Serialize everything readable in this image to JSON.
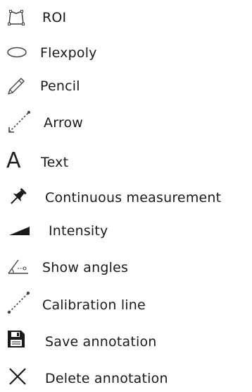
{
  "menu": {
    "items": [
      {
        "label": "ROI",
        "icon": "roi-polygon-icon"
      },
      {
        "label": "Flexpoly",
        "icon": "ellipse-icon"
      },
      {
        "label": "Pencil",
        "icon": "pencil-icon"
      },
      {
        "label": "Arrow",
        "icon": "arrow-icon"
      },
      {
        "label": "Text",
        "icon": "text-icon",
        "glyph": "A"
      },
      {
        "label": "Continuous measurement",
        "icon": "pushpin-icon"
      },
      {
        "label": "Intensity",
        "icon": "intensity-icon"
      },
      {
        "label": "Show angles",
        "icon": "angle-icon"
      },
      {
        "label": "Calibration line",
        "icon": "calibration-line-icon"
      },
      {
        "label": "Save annotation",
        "icon": "floppy-disk-icon"
      },
      {
        "label": "Delete annotation",
        "icon": "close-icon"
      }
    ]
  }
}
